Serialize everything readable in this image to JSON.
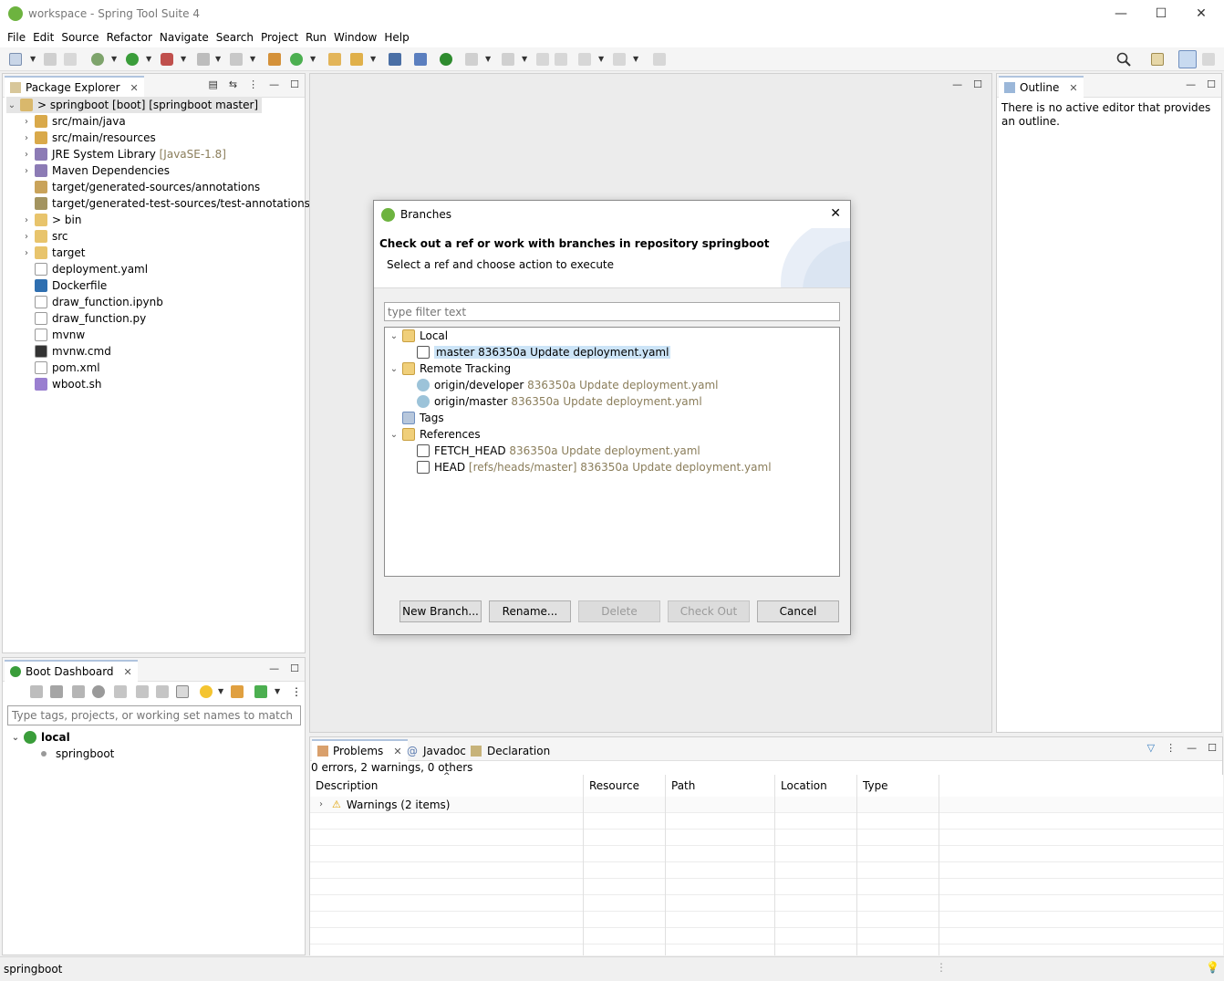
{
  "window": {
    "title": "workspace - Spring Tool Suite 4"
  },
  "menu": [
    "File",
    "Edit",
    "Source",
    "Refactor",
    "Navigate",
    "Search",
    "Project",
    "Run",
    "Window",
    "Help"
  ],
  "package_explorer": {
    "tab_label": "Package Explorer",
    "root": "> springboot [boot] [springboot master]",
    "items": [
      {
        "label": "src/main/java",
        "suffix": ""
      },
      {
        "label": "src/main/resources",
        "suffix": ""
      },
      {
        "label": "JRE System Library",
        "suffix": "[JavaSE-1.8]"
      },
      {
        "label": "Maven Dependencies",
        "suffix": ""
      },
      {
        "label": "target/generated-sources/annotations",
        "suffix": ""
      },
      {
        "label": "target/generated-test-sources/test-annotations",
        "suffix": ""
      },
      {
        "label": "> bin",
        "suffix": ""
      },
      {
        "label": "src",
        "suffix": ""
      },
      {
        "label": "target",
        "suffix": ""
      },
      {
        "label": "deployment.yaml",
        "suffix": ""
      },
      {
        "label": "Dockerfile",
        "suffix": ""
      },
      {
        "label": "draw_function.ipynb",
        "suffix": ""
      },
      {
        "label": "draw_function.py",
        "suffix": ""
      },
      {
        "label": "mvnw",
        "suffix": ""
      },
      {
        "label": "mvnw.cmd",
        "suffix": ""
      },
      {
        "label": "pom.xml",
        "suffix": ""
      },
      {
        "label": "wboot.sh",
        "suffix": ""
      }
    ]
  },
  "outline": {
    "tab_label": "Outline",
    "message": "There is no active editor that provides an outline."
  },
  "boot_dashboard": {
    "tab_label": "Boot Dashboard",
    "filter_placeholder": "Type tags, projects, or working set names to match (incl. *",
    "local_label": "local",
    "project": "springboot"
  },
  "dialog": {
    "title": "Branches",
    "heading": "Check out a ref or work with branches in repository springboot",
    "subheading": "Select a ref and choose action to execute",
    "filter_placeholder": "type filter text",
    "tree": {
      "local": "Local",
      "local_master_name": "master 836350a Update deployment.yaml",
      "remote": "Remote Tracking",
      "remote_dev_name": "origin/developer",
      "remote_dev_info": "836350a Update deployment.yaml",
      "remote_master_name": "origin/master",
      "remote_master_info": "836350a Update deployment.yaml",
      "tags": "Tags",
      "references": "References",
      "fetch_head_name": "FETCH_HEAD",
      "fetch_head_info": "836350a Update deployment.yaml",
      "head_name": "HEAD",
      "head_info": "[refs/heads/master] 836350a Update deployment.yaml"
    },
    "buttons": {
      "new_branch": "New Branch...",
      "rename": "Rename...",
      "delete": "Delete",
      "checkout": "Check Out",
      "cancel": "Cancel"
    }
  },
  "problems": {
    "tabs": {
      "problems": "Problems",
      "javadoc": "Javadoc",
      "declaration": "Declaration"
    },
    "summary": "0 errors, 2 warnings, 0 others",
    "columns": [
      "Description",
      "Resource",
      "Path",
      "Location",
      "Type"
    ],
    "warnings_row": "Warnings (2 items)"
  },
  "status": {
    "text": "springboot"
  }
}
